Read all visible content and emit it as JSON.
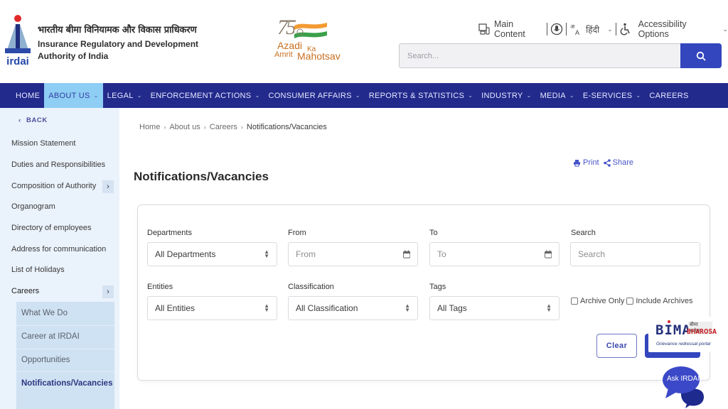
{
  "header": {
    "org_name_hindi": "भारतीय बीमा विनियामक और विकास प्राधिकरण",
    "org_name_en_line1": "Insurance Regulatory and Development",
    "org_name_en_line2": "Authority of India",
    "logo_text": "irdai",
    "azadi_logo": {
      "number": "75",
      "line1": "Azadi",
      "ka": "Ka",
      "line2a": "Amrit",
      "line2b": "Mahotsav"
    },
    "utilities": {
      "main_content": "Main Content",
      "language": "हिंदी",
      "accessibility": "Accessibility Options"
    },
    "search": {
      "placeholder": "Search..."
    }
  },
  "nav": {
    "items": [
      {
        "label": "HOME",
        "dropdown": false,
        "active": false
      },
      {
        "label": "ABOUT US",
        "dropdown": true,
        "active": true
      },
      {
        "label": "LEGAL",
        "dropdown": true,
        "active": false
      },
      {
        "label": "ENFORCEMENT ACTIONS",
        "dropdown": true,
        "active": false
      },
      {
        "label": "CONSUMER AFFAIRS",
        "dropdown": true,
        "active": false
      },
      {
        "label": "REPORTS & STATISTICS",
        "dropdown": true,
        "active": false
      },
      {
        "label": "INDUSTRY",
        "dropdown": true,
        "active": false
      },
      {
        "label": "MEDIA",
        "dropdown": true,
        "active": false
      },
      {
        "label": "E-SERVICES",
        "dropdown": true,
        "active": false
      },
      {
        "label": "CAREERS",
        "dropdown": false,
        "active": false
      }
    ]
  },
  "sidebar": {
    "back_label": "BACK",
    "items": [
      {
        "label": "Mission Statement"
      },
      {
        "label": "Duties and Responsibilities"
      },
      {
        "label": "Composition of Authority",
        "expandable": true
      },
      {
        "label": "Organogram"
      },
      {
        "label": "Directory of employees"
      },
      {
        "label": "Address for communication"
      },
      {
        "label": "List of Holidays"
      },
      {
        "label": "Careers",
        "expandable": true
      }
    ],
    "sub_items": [
      {
        "label": "What We Do"
      },
      {
        "label": "Career at IRDAI"
      },
      {
        "label": "Opportunities"
      },
      {
        "label": "Notifications/Vacancies",
        "active": true
      }
    ]
  },
  "breadcrumb": [
    "Home",
    "About us",
    "Careers",
    "Notifications/Vacancies"
  ],
  "page": {
    "title": "Notifications/Vacancies",
    "print_label": "Print",
    "share_label": "Share"
  },
  "filters": {
    "departments": {
      "label": "Departments",
      "value": "All Departments"
    },
    "from": {
      "label": "From",
      "placeholder": "From"
    },
    "to": {
      "label": "To",
      "placeholder": "To"
    },
    "search": {
      "label": "Search",
      "placeholder": "Search"
    },
    "entities": {
      "label": "Entities",
      "value": "All Entities"
    },
    "classification": {
      "label": "Classification",
      "value": "All Classification"
    },
    "tags": {
      "label": "Tags",
      "value": "All Tags"
    },
    "archive_only": {
      "label": "Archive Only",
      "checked": false
    },
    "include_archives": {
      "label": "Include Archives",
      "checked": false
    },
    "clear_label": "Clear"
  },
  "widgets": {
    "bima": {
      "main": "BIMA",
      "hindi": "बीमा भरोसा",
      "bharosa": "BHAROSA",
      "tagline": "Grievance redressal portal"
    },
    "ask": "Ask IRDAI"
  },
  "colors": {
    "nav_bg": "#222a8c",
    "nav_active": "#8ecdf4",
    "primary": "#3346be",
    "sidebar_bg": "#eaf2fb"
  }
}
